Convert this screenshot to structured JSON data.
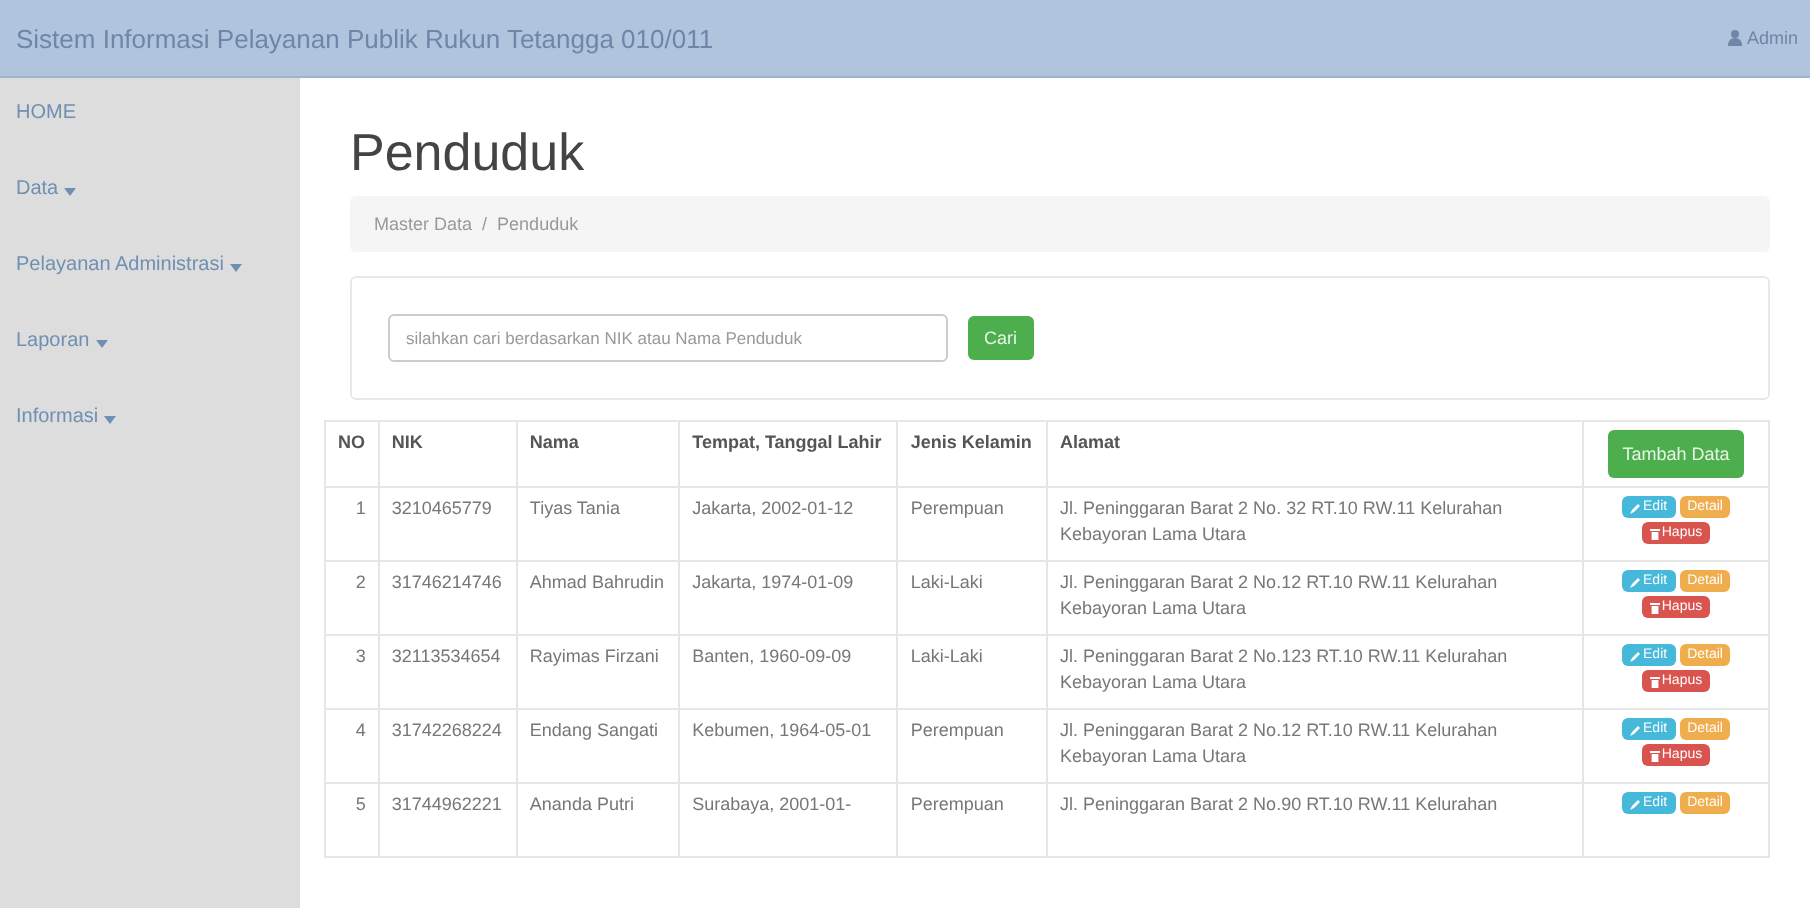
{
  "navbar": {
    "title": "Sistem Informasi Pelayanan Publik Rukun Tetangga 010/011",
    "user": "Admin"
  },
  "sidebar": {
    "items": [
      {
        "label": "HOME",
        "dropdown": false
      },
      {
        "label": "Data",
        "dropdown": true
      },
      {
        "label": "Pelayanan Administrasi",
        "dropdown": true
      },
      {
        "label": "Laporan",
        "dropdown": true
      },
      {
        "label": "Informasi",
        "dropdown": true
      }
    ]
  },
  "page": {
    "title": "Penduduk",
    "breadcrumb": [
      "Master Data",
      "Penduduk"
    ],
    "breadcrumb_separator": "/"
  },
  "search": {
    "placeholder": "silahkan cari berdasarkan NIK atau Nama Penduduk",
    "button": "Cari"
  },
  "table": {
    "columns": [
      "NO",
      "NIK",
      "Nama",
      "Tempat, Tanggal Lahir",
      "Jenis Kelamin",
      "Alamat"
    ],
    "add_button": "Tambah Data",
    "rows": [
      {
        "cells": [
          "1",
          "3210465779",
          "Tiyas Tania",
          "Jakarta, 2002-01-12",
          "Perempuan",
          "Jl. Peninggaran Barat 2 No. 32 RT.10 RW.11 Kelurahan Kebayoran Lama Utara"
        ],
        "actions": [
          "Edit",
          "Detail",
          "Hapus"
        ]
      },
      {
        "cells": [
          "2",
          "31746214746",
          "Ahmad Bahrudin",
          "Jakarta, 1974-01-09",
          "Laki-Laki",
          "Jl. Peninggaran Barat 2 No.12 RT.10 RW.11 Kelurahan Kebayoran Lama Utara"
        ],
        "actions": [
          "Edit",
          "Detail",
          "Hapus"
        ]
      },
      {
        "cells": [
          "3",
          "32113534654",
          "Rayimas Firzani",
          "Banten, 1960-09-09",
          "Laki-Laki",
          "Jl. Peninggaran Barat 2 No.123 RT.10 RW.11 Kelurahan Kebayoran Lama Utara"
        ],
        "actions": [
          "Edit",
          "Detail",
          "Hapus"
        ]
      },
      {
        "cells": [
          "4",
          "31742268224",
          "Endang Sangati",
          "Kebumen, 1964-05-01",
          "Perempuan",
          "Jl. Peninggaran Barat 2 No.12 RT.10 RW.11 Kelurahan Kebayoran Lama Utara"
        ],
        "actions": [
          "Edit",
          "Detail",
          "Hapus"
        ]
      },
      {
        "cells": [
          "5",
          "31744962221",
          "Ananda Putri",
          "Surabaya, 2001-01-",
          "Perempuan",
          "Jl. Peninggaran Barat 2 No.90 RT.10 RW.11 Kelurahan"
        ],
        "actions": [
          "Edit",
          "Detail"
        ]
      }
    ]
  }
}
